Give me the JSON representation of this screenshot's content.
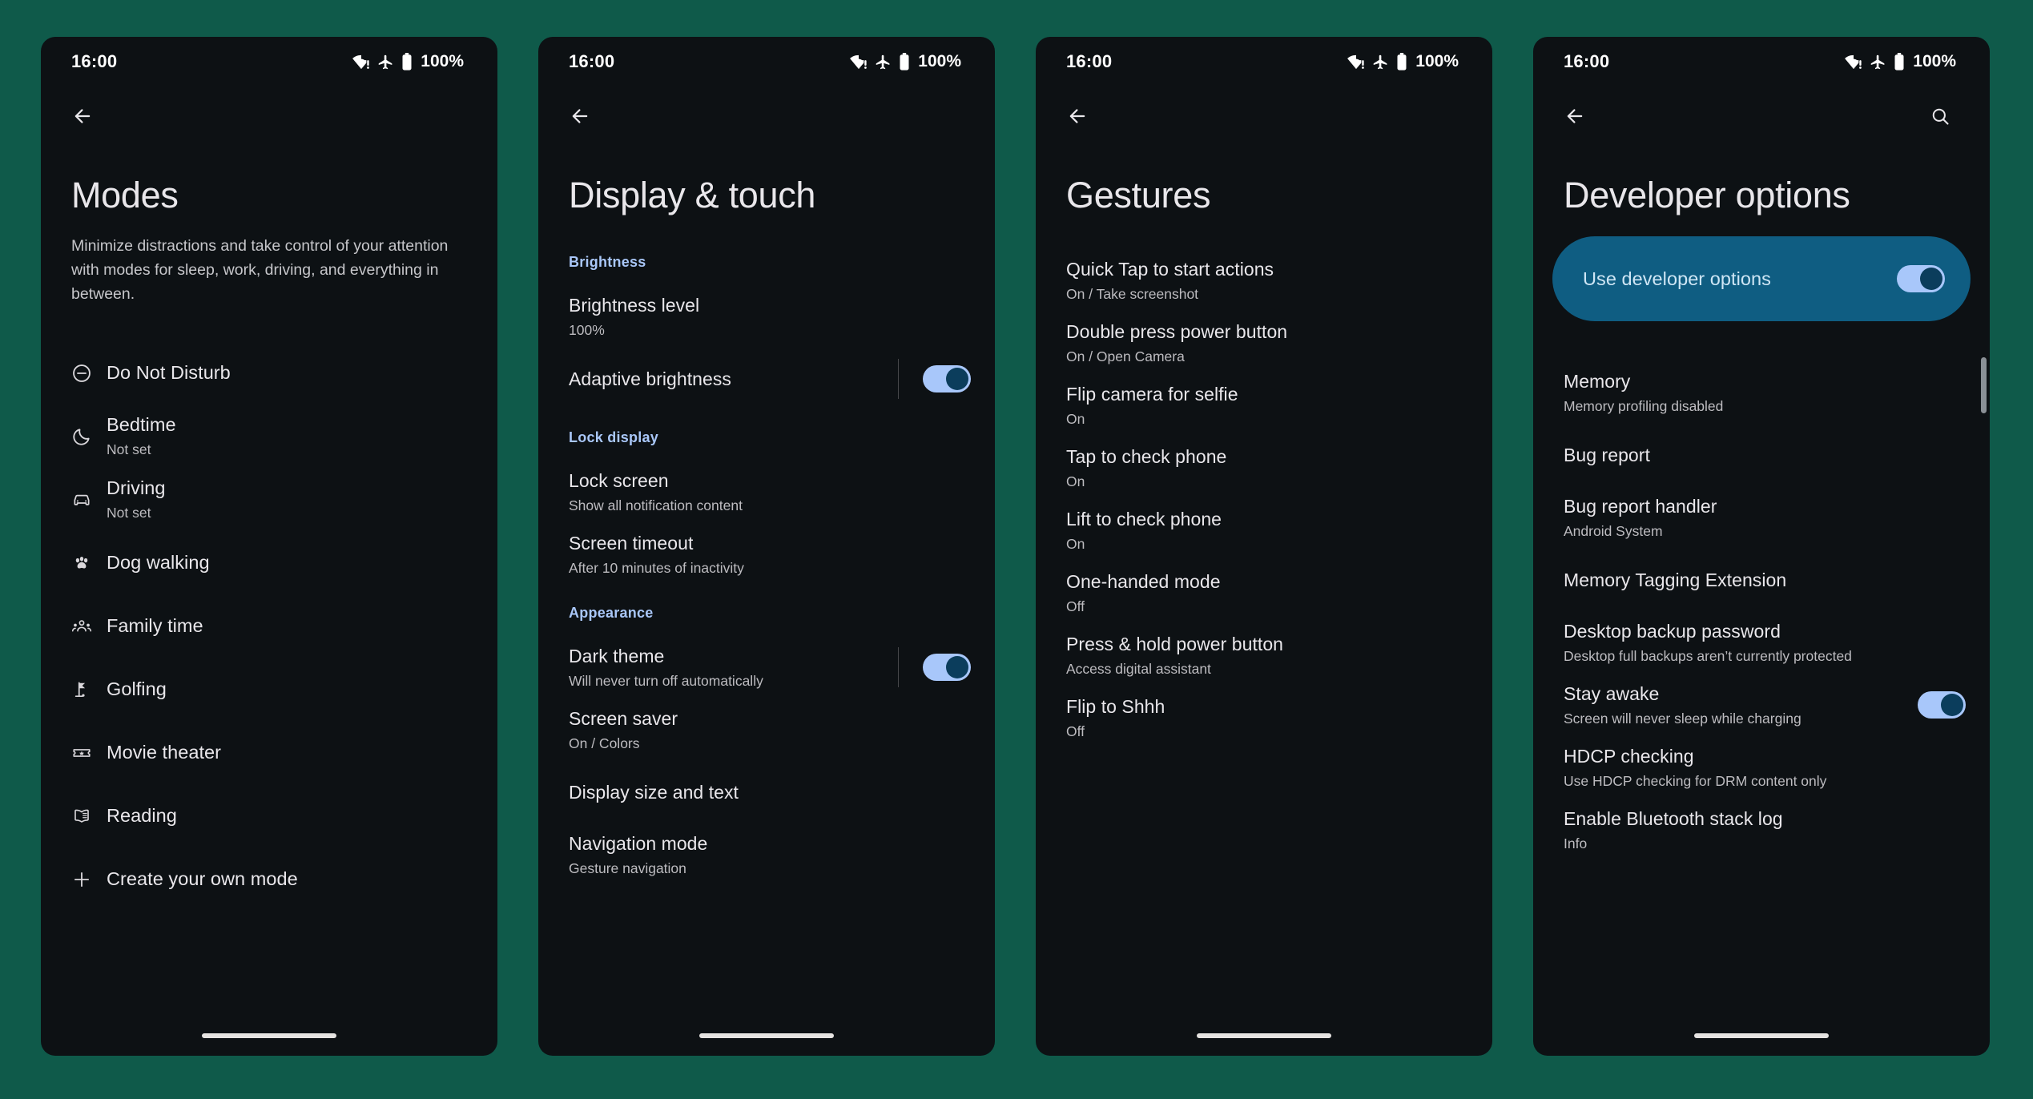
{
  "theme": {
    "page_background": "#0f5a4a",
    "phone_background": "#0d1114",
    "accent_blue": "#a9c7f8",
    "toggle_on_track": "#a8c7fa",
    "toggle_on_thumb": "#0b3d5c",
    "highlight_card": "#0f5d82"
  },
  "status_bar": {
    "time": "16:00",
    "battery": "100%",
    "icons": [
      "wifi-alert-icon",
      "airplane-mode-icon",
      "battery-full-icon"
    ]
  },
  "screens": [
    {
      "id": "modes",
      "nav": {
        "back": "back-arrow-icon"
      },
      "title": "Modes",
      "description": "Minimize distractions and take control of your attention with modes for sleep, work, driving, and everything in between.",
      "items": [
        {
          "icon": "do-not-disturb-icon",
          "title": "Do Not Disturb",
          "sub": ""
        },
        {
          "icon": "moon-icon",
          "title": "Bedtime",
          "sub": "Not set"
        },
        {
          "icon": "car-icon",
          "title": "Driving",
          "sub": "Not set"
        },
        {
          "icon": "paw-icon",
          "title": "Dog walking",
          "sub": ""
        },
        {
          "icon": "family-icon",
          "title": "Family time",
          "sub": ""
        },
        {
          "icon": "golf-flag-icon",
          "title": "Golfing",
          "sub": ""
        },
        {
          "icon": "ticket-star-icon",
          "title": "Movie theater",
          "sub": ""
        },
        {
          "icon": "open-book-icon",
          "title": "Reading",
          "sub": ""
        },
        {
          "icon": "plus-icon",
          "title": "Create your own mode",
          "sub": ""
        }
      ]
    },
    {
      "id": "display-touch",
      "nav": {
        "back": "back-arrow-icon"
      },
      "title": "Display & touch",
      "sections": [
        {
          "header": "Brightness",
          "items": [
            {
              "title": "Brightness level",
              "sub": "100%",
              "toggle": null
            },
            {
              "title": "Adaptive brightness",
              "sub": "",
              "toggle": true
            }
          ]
        },
        {
          "header": "Lock display",
          "items": [
            {
              "title": "Lock screen",
              "sub": "Show all notification content",
              "toggle": null
            },
            {
              "title": "Screen timeout",
              "sub": "After 10 minutes of inactivity",
              "toggle": null
            }
          ]
        },
        {
          "header": "Appearance",
          "items": [
            {
              "title": "Dark theme",
              "sub": "Will never turn off automatically",
              "toggle": true
            },
            {
              "title": "Screen saver",
              "sub": "On / Colors",
              "toggle": null
            },
            {
              "title": "Display size and text",
              "sub": "",
              "toggle": null
            },
            {
              "title": "Navigation mode",
              "sub": "Gesture navigation",
              "toggle": null
            }
          ]
        }
      ]
    },
    {
      "id": "gestures",
      "nav": {
        "back": "back-arrow-icon"
      },
      "title": "Gestures",
      "items": [
        {
          "title": "Quick Tap to start actions",
          "sub": "On / Take screenshot"
        },
        {
          "title": "Double press power button",
          "sub": "On / Open Camera"
        },
        {
          "title": "Flip camera for selfie",
          "sub": "On"
        },
        {
          "title": "Tap to check phone",
          "sub": "On"
        },
        {
          "title": "Lift to check phone",
          "sub": "On"
        },
        {
          "title": "One-handed mode",
          "sub": "Off"
        },
        {
          "title": "Press & hold power button",
          "sub": "Access digital assistant"
        },
        {
          "title": "Flip to Shhh",
          "sub": "Off"
        }
      ]
    },
    {
      "id": "developer-options",
      "nav": {
        "back": "back-arrow-icon",
        "search": "search-icon"
      },
      "title": "Developer options",
      "highlight": {
        "label": "Use developer options",
        "toggle": true
      },
      "items": [
        {
          "title": "Memory",
          "sub": "Memory profiling disabled",
          "toggle": null
        },
        {
          "title": "Bug report",
          "sub": "",
          "toggle": null
        },
        {
          "title": "Bug report handler",
          "sub": "Android System",
          "toggle": null
        },
        {
          "title": "Memory Tagging Extension",
          "sub": "",
          "toggle": null
        },
        {
          "title": "Desktop backup password",
          "sub": "Desktop full backups aren’t currently protected",
          "toggle": null
        },
        {
          "title": "Stay awake",
          "sub": "Screen will never sleep while charging",
          "toggle": true
        },
        {
          "title": "HDCP checking",
          "sub": "Use HDCP checking for DRM content only",
          "toggle": null
        },
        {
          "title": "Enable Bluetooth stack log",
          "sub": "Info",
          "toggle": null
        }
      ]
    }
  ]
}
